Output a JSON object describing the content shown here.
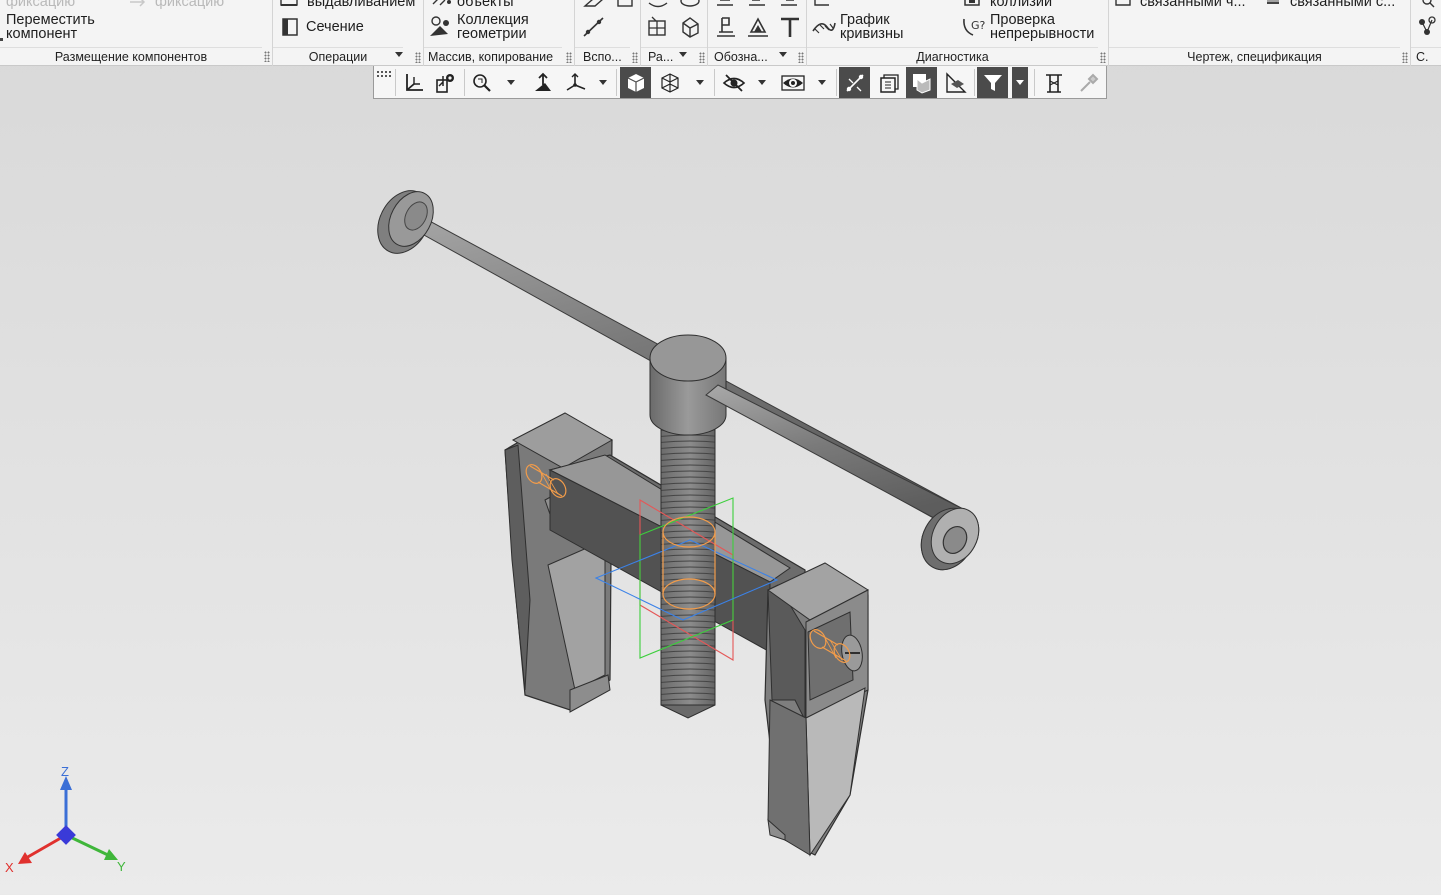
{
  "ribbon": {
    "placement_group": {
      "footer": "Размещение компонентов",
      "top_faded_left": "фиксацию",
      "top_faded_right": "фиксацию",
      "move_component": [
        "Переместить",
        "компонент"
      ]
    },
    "operations_group": {
      "footer": "Операции",
      "extrude_partial": "выдавливанием",
      "section": "Сечение"
    },
    "array_group": {
      "footer": "Массив, копирование",
      "objects_partial": "объекты",
      "geometry_collection": [
        "Коллекция",
        "геометрии"
      ]
    },
    "aux_group": {
      "footer": "Вспо..."
    },
    "ra_group": {
      "footer": "Ра..."
    },
    "notation_group": {
      "footer": "Обозна..."
    },
    "diagnostics_group": {
      "footer": "Диагностика",
      "collisions_partial": "коллизий",
      "curvature_graph": [
        "График",
        "кривизны"
      ],
      "continuity_check": [
        "Проверка",
        "непрерывности"
      ]
    },
    "drawing_group": {
      "footer": "Чертеж, спецификация",
      "linked_left": "связанными ч...",
      "linked_right": "связанными с..."
    },
    "last_group": {
      "footer": "С."
    }
  },
  "viewbar": {
    "icons": [
      "grid-icon",
      "orientation-icon",
      "view-selection-icon",
      "zoom-icon",
      "rotate-icon",
      "axes-icon",
      "shaded-icon",
      "wireframe-icon",
      "hide-icon",
      "section-view-icon",
      "snap-icon",
      "layers-icon",
      "display-mode-icon",
      "perspective-icon",
      "filter-icon",
      "measure-icon",
      "eyedropper-icon"
    ]
  },
  "axes": {
    "x": "X",
    "y": "Y",
    "z": "Z"
  },
  "colors": {
    "axis_x": "#e0312e",
    "axis_y": "#3fb63a",
    "axis_z": "#3b6fd6",
    "selection_highlight": "#f29c4a",
    "plane_red": "#e55757",
    "plane_green": "#3ccf3c",
    "plane_blue": "#3b82e8",
    "model_gray": "#8f8f8f"
  }
}
